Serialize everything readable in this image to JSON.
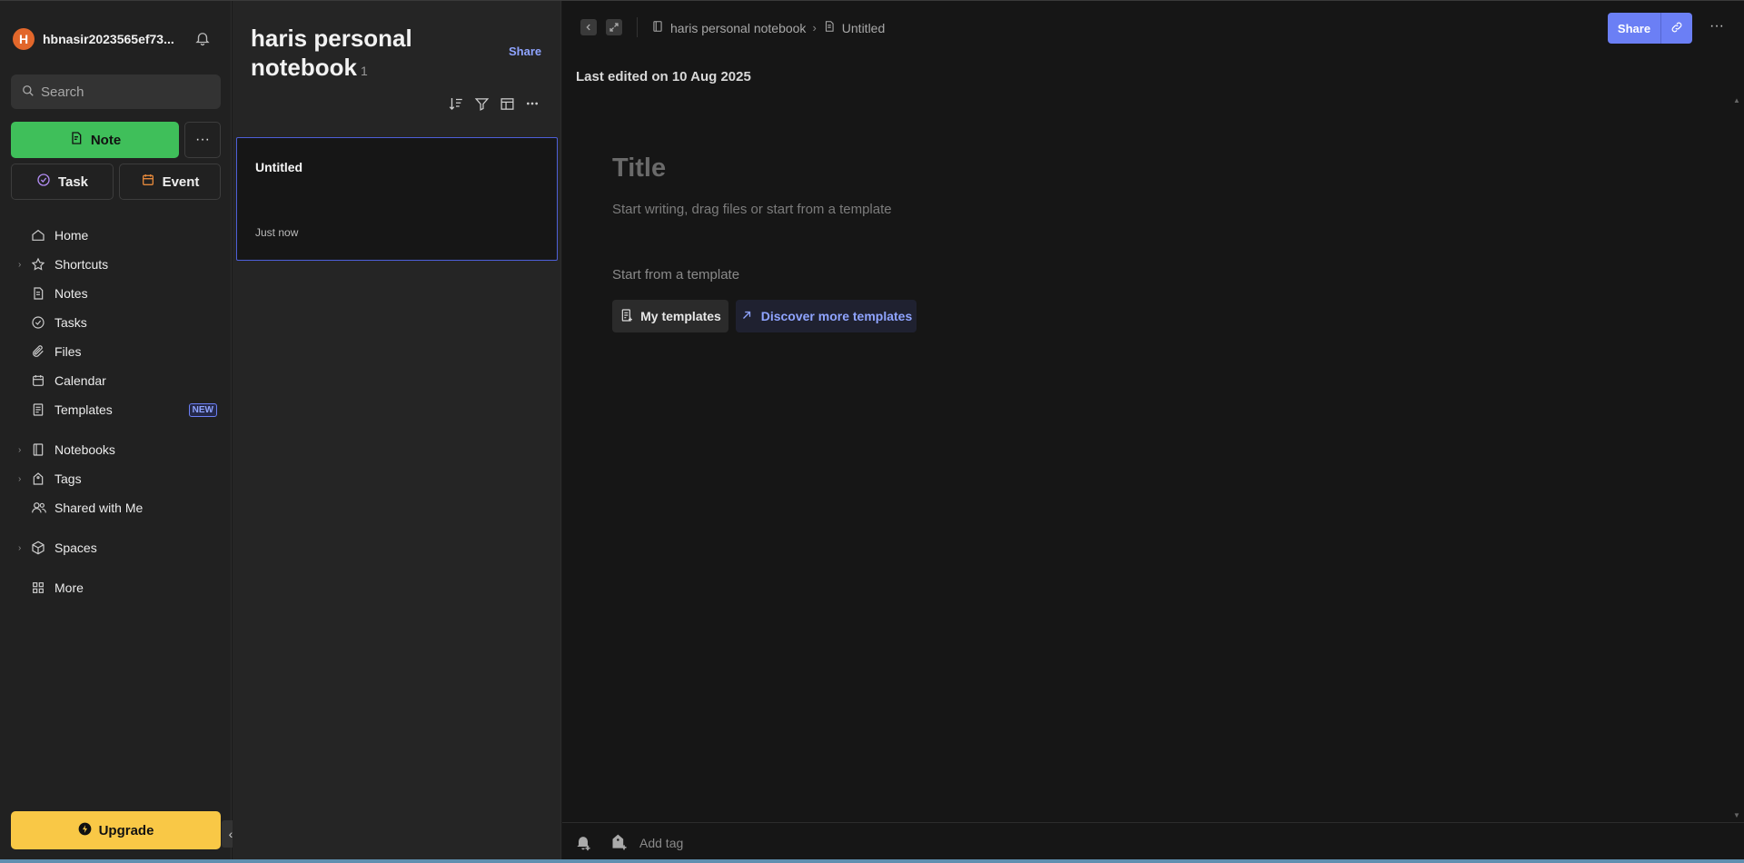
{
  "account": {
    "initial": "H",
    "name": "hbnasir2023565ef73..."
  },
  "search": {
    "placeholder": "Search"
  },
  "actions": {
    "note": "Note",
    "more": "···",
    "task": "Task",
    "event": "Event"
  },
  "nav": [
    {
      "label": "Home",
      "icon": "home-icon"
    },
    {
      "label": "Shortcuts",
      "icon": "star-icon"
    },
    {
      "label": "Notes",
      "icon": "note-icon"
    },
    {
      "label": "Tasks",
      "icon": "check-circle-icon"
    },
    {
      "label": "Files",
      "icon": "paperclip-icon"
    },
    {
      "label": "Calendar",
      "icon": "calendar-icon"
    },
    {
      "label": "Templates",
      "icon": "template-icon",
      "badge": "NEW"
    },
    {
      "label": "Notebooks",
      "icon": "notebook-icon"
    },
    {
      "label": "Tags",
      "icon": "tag-icon"
    },
    {
      "label": "Shared with Me",
      "icon": "people-icon"
    },
    {
      "label": "Spaces",
      "icon": "cube-icon"
    },
    {
      "label": "More",
      "icon": "grid-icon"
    }
  ],
  "upgrade": "Upgrade",
  "notebook": {
    "title": "haris personal notebook",
    "count": "1",
    "share": "Share"
  },
  "notes": [
    {
      "title": "Untitled",
      "time": "Just now"
    }
  ],
  "editor": {
    "breadcrumb_notebook": "haris personal notebook",
    "breadcrumb_note": "Untitled",
    "share": "Share",
    "more": "···",
    "last_edited": "Last edited on 10 Aug 2025",
    "title_placeholder": "Title",
    "body_placeholder": "Start writing, drag files or start from a template",
    "template_heading": "Start from a template",
    "my_templates": "My templates",
    "discover": "Discover more templates",
    "add_tag_placeholder": "Add tag"
  },
  "colors": {
    "accent": "#6b7ff5",
    "note_green": "#3fbf5a",
    "upgrade_yellow": "#f9c846",
    "avatar": "#e2672b"
  }
}
